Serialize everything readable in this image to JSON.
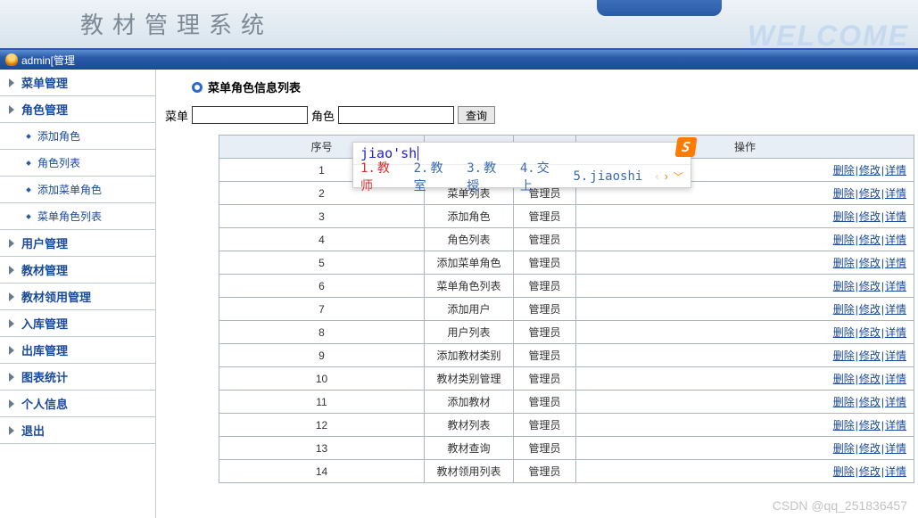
{
  "banner": {
    "title": "教材管理系统",
    "welcome": "WELCOME"
  },
  "userbar": {
    "text": "admin[管理"
  },
  "sidebar": [
    {
      "label": "菜单管理",
      "type": "item"
    },
    {
      "label": "角色管理",
      "type": "item"
    },
    {
      "label": "添加角色",
      "type": "sub"
    },
    {
      "label": "角色列表",
      "type": "sub"
    },
    {
      "label": "添加菜单角色",
      "type": "sub"
    },
    {
      "label": "菜单角色列表",
      "type": "sub"
    },
    {
      "label": "用户管理",
      "type": "item"
    },
    {
      "label": "教材管理",
      "type": "item"
    },
    {
      "label": "教材领用管理",
      "type": "item"
    },
    {
      "label": "入库管理",
      "type": "item"
    },
    {
      "label": "出库管理",
      "type": "item"
    },
    {
      "label": "图表统计",
      "type": "item"
    },
    {
      "label": "个人信息",
      "type": "item"
    },
    {
      "label": "退出",
      "type": "item"
    }
  ],
  "page": {
    "title": "菜单角色信息列表",
    "search": {
      "menu_label": "菜单",
      "role_label": "角色",
      "menu_value": "",
      "role_value": "",
      "button": "查询"
    }
  },
  "table": {
    "headers": {
      "seq": "序号",
      "menu": "",
      "role": "",
      "op": "操作"
    },
    "op_labels": {
      "delete": "删除",
      "edit": "修改",
      "detail": "详情"
    },
    "rows": [
      {
        "seq": "1",
        "menu": "",
        "role": ""
      },
      {
        "seq": "2",
        "menu": "菜单列表",
        "role": "管理员"
      },
      {
        "seq": "3",
        "menu": "添加角色",
        "role": "管理员"
      },
      {
        "seq": "4",
        "menu": "角色列表",
        "role": "管理员"
      },
      {
        "seq": "5",
        "menu": "添加菜单角色",
        "role": "管理员"
      },
      {
        "seq": "6",
        "menu": "菜单角色列表",
        "role": "管理员"
      },
      {
        "seq": "7",
        "menu": "添加用户",
        "role": "管理员"
      },
      {
        "seq": "8",
        "menu": "用户列表",
        "role": "管理员"
      },
      {
        "seq": "9",
        "menu": "添加教材类别",
        "role": "管理员"
      },
      {
        "seq": "10",
        "menu": "教材类别管理",
        "role": "管理员"
      },
      {
        "seq": "11",
        "menu": "添加教材",
        "role": "管理员"
      },
      {
        "seq": "12",
        "menu": "教材列表",
        "role": "管理员"
      },
      {
        "seq": "13",
        "menu": "教材查询",
        "role": "管理员"
      },
      {
        "seq": "14",
        "menu": "教材领用列表",
        "role": "管理员"
      }
    ]
  },
  "ime": {
    "input": "jiao'sh",
    "logo": "S",
    "candidates": [
      {
        "n": "1.",
        "text": "教师"
      },
      {
        "n": "2.",
        "text": "教室"
      },
      {
        "n": "3.",
        "text": "教授"
      },
      {
        "n": "4.",
        "text": "交上"
      },
      {
        "n": "5.",
        "text": "jiaoshi"
      }
    ]
  },
  "watermark": "CSDN @qq_251836457"
}
